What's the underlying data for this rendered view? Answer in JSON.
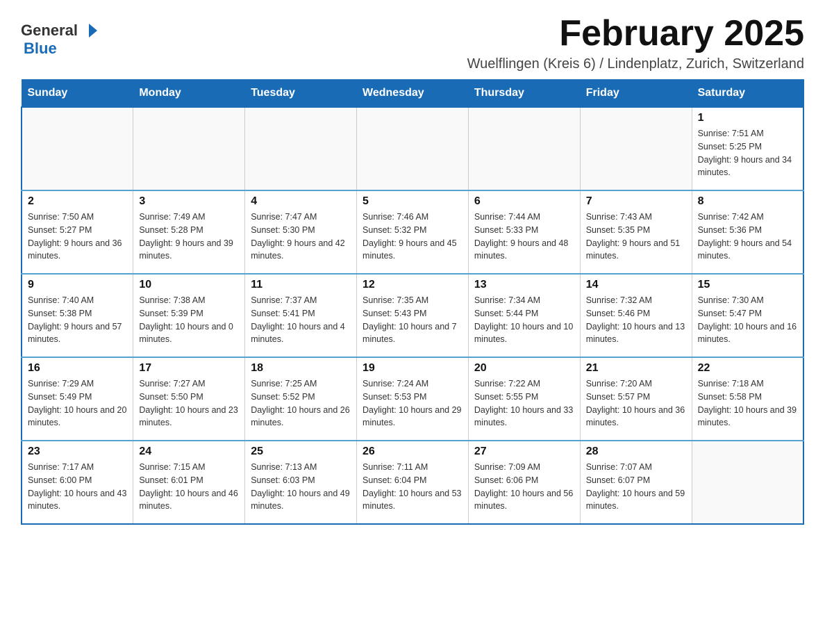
{
  "header": {
    "logo_general": "General",
    "logo_blue": "Blue",
    "title": "February 2025",
    "subtitle": "Wuelflingen (Kreis 6) / Lindenplatz, Zurich, Switzerland"
  },
  "weekdays": [
    "Sunday",
    "Monday",
    "Tuesday",
    "Wednesday",
    "Thursday",
    "Friday",
    "Saturday"
  ],
  "weeks": [
    [
      {
        "day": "",
        "info": ""
      },
      {
        "day": "",
        "info": ""
      },
      {
        "day": "",
        "info": ""
      },
      {
        "day": "",
        "info": ""
      },
      {
        "day": "",
        "info": ""
      },
      {
        "day": "",
        "info": ""
      },
      {
        "day": "1",
        "info": "Sunrise: 7:51 AM\nSunset: 5:25 PM\nDaylight: 9 hours and 34 minutes."
      }
    ],
    [
      {
        "day": "2",
        "info": "Sunrise: 7:50 AM\nSunset: 5:27 PM\nDaylight: 9 hours and 36 minutes."
      },
      {
        "day": "3",
        "info": "Sunrise: 7:49 AM\nSunset: 5:28 PM\nDaylight: 9 hours and 39 minutes."
      },
      {
        "day": "4",
        "info": "Sunrise: 7:47 AM\nSunset: 5:30 PM\nDaylight: 9 hours and 42 minutes."
      },
      {
        "day": "5",
        "info": "Sunrise: 7:46 AM\nSunset: 5:32 PM\nDaylight: 9 hours and 45 minutes."
      },
      {
        "day": "6",
        "info": "Sunrise: 7:44 AM\nSunset: 5:33 PM\nDaylight: 9 hours and 48 minutes."
      },
      {
        "day": "7",
        "info": "Sunrise: 7:43 AM\nSunset: 5:35 PM\nDaylight: 9 hours and 51 minutes."
      },
      {
        "day": "8",
        "info": "Sunrise: 7:42 AM\nSunset: 5:36 PM\nDaylight: 9 hours and 54 minutes."
      }
    ],
    [
      {
        "day": "9",
        "info": "Sunrise: 7:40 AM\nSunset: 5:38 PM\nDaylight: 9 hours and 57 minutes."
      },
      {
        "day": "10",
        "info": "Sunrise: 7:38 AM\nSunset: 5:39 PM\nDaylight: 10 hours and 0 minutes."
      },
      {
        "day": "11",
        "info": "Sunrise: 7:37 AM\nSunset: 5:41 PM\nDaylight: 10 hours and 4 minutes."
      },
      {
        "day": "12",
        "info": "Sunrise: 7:35 AM\nSunset: 5:43 PM\nDaylight: 10 hours and 7 minutes."
      },
      {
        "day": "13",
        "info": "Sunrise: 7:34 AM\nSunset: 5:44 PM\nDaylight: 10 hours and 10 minutes."
      },
      {
        "day": "14",
        "info": "Sunrise: 7:32 AM\nSunset: 5:46 PM\nDaylight: 10 hours and 13 minutes."
      },
      {
        "day": "15",
        "info": "Sunrise: 7:30 AM\nSunset: 5:47 PM\nDaylight: 10 hours and 16 minutes."
      }
    ],
    [
      {
        "day": "16",
        "info": "Sunrise: 7:29 AM\nSunset: 5:49 PM\nDaylight: 10 hours and 20 minutes."
      },
      {
        "day": "17",
        "info": "Sunrise: 7:27 AM\nSunset: 5:50 PM\nDaylight: 10 hours and 23 minutes."
      },
      {
        "day": "18",
        "info": "Sunrise: 7:25 AM\nSunset: 5:52 PM\nDaylight: 10 hours and 26 minutes."
      },
      {
        "day": "19",
        "info": "Sunrise: 7:24 AM\nSunset: 5:53 PM\nDaylight: 10 hours and 29 minutes."
      },
      {
        "day": "20",
        "info": "Sunrise: 7:22 AM\nSunset: 5:55 PM\nDaylight: 10 hours and 33 minutes."
      },
      {
        "day": "21",
        "info": "Sunrise: 7:20 AM\nSunset: 5:57 PM\nDaylight: 10 hours and 36 minutes."
      },
      {
        "day": "22",
        "info": "Sunrise: 7:18 AM\nSunset: 5:58 PM\nDaylight: 10 hours and 39 minutes."
      }
    ],
    [
      {
        "day": "23",
        "info": "Sunrise: 7:17 AM\nSunset: 6:00 PM\nDaylight: 10 hours and 43 minutes."
      },
      {
        "day": "24",
        "info": "Sunrise: 7:15 AM\nSunset: 6:01 PM\nDaylight: 10 hours and 46 minutes."
      },
      {
        "day": "25",
        "info": "Sunrise: 7:13 AM\nSunset: 6:03 PM\nDaylight: 10 hours and 49 minutes."
      },
      {
        "day": "26",
        "info": "Sunrise: 7:11 AM\nSunset: 6:04 PM\nDaylight: 10 hours and 53 minutes."
      },
      {
        "day": "27",
        "info": "Sunrise: 7:09 AM\nSunset: 6:06 PM\nDaylight: 10 hours and 56 minutes."
      },
      {
        "day": "28",
        "info": "Sunrise: 7:07 AM\nSunset: 6:07 PM\nDaylight: 10 hours and 59 minutes."
      },
      {
        "day": "",
        "info": ""
      }
    ]
  ]
}
